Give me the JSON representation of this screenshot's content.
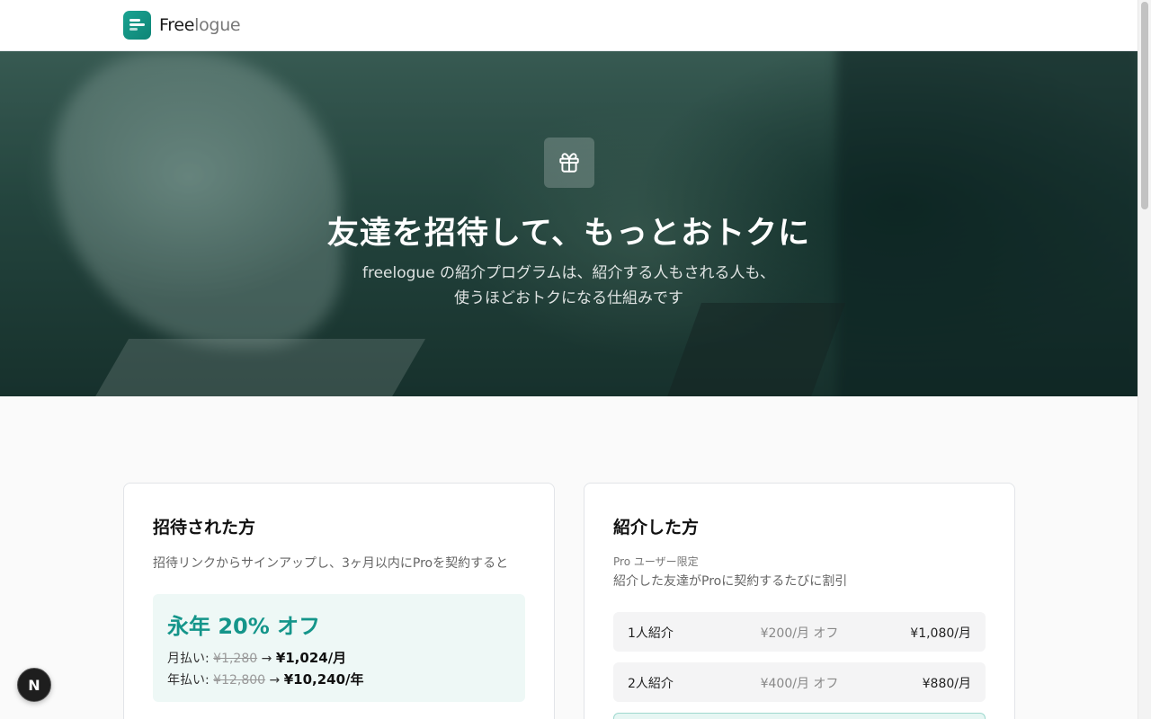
{
  "brand": {
    "name_bold": "Free",
    "name_light": "logue"
  },
  "hero": {
    "title": "友達を招待して、もっとおトクに",
    "subtitle_line1": "freelogue の紹介プログラムは、紹介する人もされる人も、",
    "subtitle_line2": "使うほどおトクになる仕組みです",
    "icon": "gift-icon"
  },
  "invited": {
    "title": "招待された方",
    "description": "招待リンクからサインアップし、3ヶ月以内にProを契約すると",
    "offer_title": "永年 20% オフ",
    "monthly_label": "月払い: ",
    "monthly_old": "¥1,280",
    "monthly_arrow": " → ",
    "monthly_new": "¥1,024/月",
    "yearly_label": "年払い: ",
    "yearly_old": "¥12,800",
    "yearly_arrow": " → ",
    "yearly_new": "¥10,240/年"
  },
  "referrer": {
    "title": "紹介した方",
    "note": "Pro ユーザー限定",
    "description": "紹介した友達がProに契約するたびに割引",
    "tiers": [
      {
        "name": "1人紹介",
        "off": "¥200/月 オフ",
        "price": "¥1,080/月"
      },
      {
        "name": "2人紹介",
        "off": "¥400/月 オフ",
        "price": "¥880/月"
      }
    ]
  },
  "dev_badge": {
    "label": "N"
  },
  "colors": {
    "accent": "#14958a",
    "hero_overlay": "#0e342e"
  }
}
